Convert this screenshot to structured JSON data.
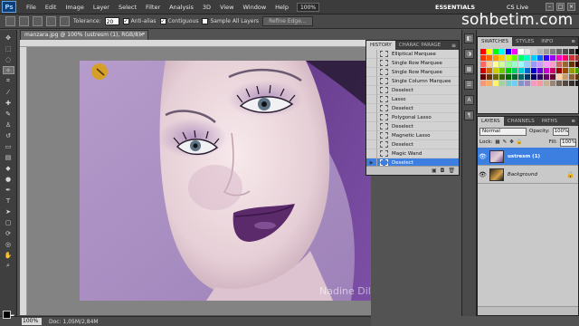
{
  "menubar": {
    "logo": "Ps",
    "items": [
      "File",
      "Edit",
      "Image",
      "Layer",
      "Select",
      "Filter",
      "Analysis",
      "3D",
      "View",
      "Window",
      "Help"
    ],
    "zoom": "100%",
    "workspace": "ESSENTIALS",
    "cs_live": "CS Live",
    "win_buttons": [
      "–",
      "□",
      "×"
    ]
  },
  "watermark": "sohbetim.com",
  "options": {
    "tolerance_label": "Tolerance:",
    "tolerance_value": "20",
    "anti_alias_label": "Anti-alias",
    "contiguous_label": "Contiguous",
    "sample_all_label": "Sample All Layers",
    "refine_edge_label": "Refine Edge..."
  },
  "document": {
    "tab_title": "manzara.jpg @ 100% (ustresm (1), RGB/8) *",
    "tab_close": "×",
    "photo_signature": "Nadine Dilly",
    "status_zoom": "100%",
    "status_doc": "Doc: 1,05M/2,84M"
  },
  "history": {
    "tabs": [
      "HISTORY",
      "CHARAC PARAGE"
    ],
    "items": [
      {
        "label": "Elliptical Marquee"
      },
      {
        "label": "Single Row Marquee"
      },
      {
        "label": "Single Row Marquee"
      },
      {
        "label": "Single Column Marquee"
      },
      {
        "label": "Deselect"
      },
      {
        "label": "Lasso"
      },
      {
        "label": "Deselect"
      },
      {
        "label": "Polygonal Lasso"
      },
      {
        "label": "Deselect"
      },
      {
        "label": "Magnetic Lasso"
      },
      {
        "label": "Deselect"
      },
      {
        "label": "Magic Wand"
      },
      {
        "label": "Deselect"
      }
    ],
    "selected_index": 12
  },
  "swatches": {
    "tabs": [
      "SWATCHES",
      "STYLES",
      "INFO"
    ],
    "colors": [
      "#ff0000",
      "#ffff00",
      "#00ff00",
      "#00ffff",
      "#0000ff",
      "#ff00ff",
      "#ffffff",
      "#e6e6e6",
      "#cccccc",
      "#b3b3b3",
      "#999999",
      "#808080",
      "#666666",
      "#4d4d4d",
      "#333333",
      "#000000",
      "#ff3300",
      "#ff6600",
      "#ff9900",
      "#ffcc00",
      "#ccff00",
      "#66ff00",
      "#00ff66",
      "#00ffcc",
      "#00ccff",
      "#0066ff",
      "#3300ff",
      "#9900ff",
      "#ff00cc",
      "#ff0066",
      "#cc3333",
      "#993333",
      "#ff6666",
      "#ffcc99",
      "#ffff99",
      "#ccff99",
      "#99ff99",
      "#99ffcc",
      "#99ffff",
      "#99ccff",
      "#9999ff",
      "#cc99ff",
      "#ff99ff",
      "#ff99cc",
      "#cc6666",
      "#996633",
      "#663300",
      "#330000",
      "#cc0000",
      "#cc6600",
      "#cccc00",
      "#66cc00",
      "#00cc00",
      "#00cc66",
      "#00cccc",
      "#0066cc",
      "#0000cc",
      "#6600cc",
      "#cc00cc",
      "#cc0066",
      "#990000",
      "#994c00",
      "#999900",
      "#4c9900",
      "#660000",
      "#663300",
      "#666600",
      "#336600",
      "#006600",
      "#006633",
      "#006666",
      "#003366",
      "#000066",
      "#330066",
      "#660066",
      "#660033",
      "#ffd1a8",
      "#c69c6d",
      "#8c6239",
      "#603813",
      "#f7977a",
      "#fbaf5d",
      "#fff568",
      "#a2d39c",
      "#7accc8",
      "#6dcff6",
      "#8393ca",
      "#a187be",
      "#f49ac1",
      "#f6989d",
      "#c7b299",
      "#998675",
      "#736357",
      "#534741",
      "#362f2d",
      "#1a1a1a"
    ]
  },
  "layers": {
    "tabs": [
      "LAYERS",
      "CHANNELS",
      "PATHS"
    ],
    "blend_mode": "Normal",
    "opacity_label": "Opacity:",
    "opacity_value": "100%",
    "lock_label": "Lock:",
    "fill_label": "Fill:",
    "fill_value": "100%",
    "items": [
      {
        "name": "ustresm (1)",
        "selected": true
      },
      {
        "name": "Background",
        "selected": false
      }
    ]
  }
}
